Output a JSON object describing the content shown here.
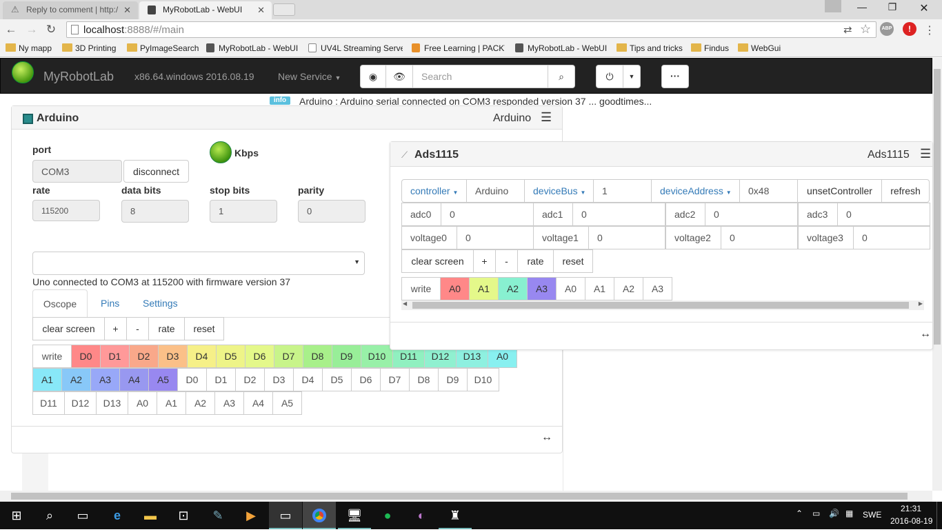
{
  "browser": {
    "tabs": [
      {
        "title": "Reply to comment | http:/"
      },
      {
        "title": "MyRobotLab - WebUI"
      }
    ],
    "url_host": "localhost",
    "url_rest": ":8888/#/main",
    "bookmarks": [
      "Ny mapp",
      "3D Printing",
      "PyImageSearch",
      "MyRobotLab - WebUI",
      "UV4L Streaming Serve",
      "Free Learning | PACKT",
      "MyRobotLab - WebUI",
      "Tips and tricks",
      "Findus",
      "WebGui"
    ],
    "ext_abp": "ABP"
  },
  "navbar": {
    "brand": "MyRobotLab",
    "platform": "x86.64.windows 2016.08.19",
    "new_service": "New Service",
    "search_placeholder": "Search",
    "more": "···"
  },
  "notice": {
    "badge": "info",
    "text": "Arduino : Arduino serial connected on COM3 responded version 37 ... goodtimes..."
  },
  "arduino": {
    "title": "Arduino",
    "header_right": "Arduino",
    "port_label": "port",
    "port_value": "COM3",
    "disconnect": "disconnect",
    "kbps": "Kbps",
    "rate_label": "rate",
    "rate_value": "115200",
    "databits_label": "data bits",
    "databits_value": "8",
    "stopbits_label": "stop bits",
    "stopbits_value": "1",
    "parity_label": "parity",
    "parity_value": "0",
    "status": "Uno connected to COM3 at 115200 with firmware version 37",
    "tabs": [
      "Oscope",
      "Pins",
      "Settings"
    ],
    "controls": [
      "clear screen",
      "+",
      "-",
      "rate",
      "reset"
    ],
    "pins_row1": [
      "write",
      "D0",
      "D1",
      "D2",
      "D3",
      "D4",
      "D5",
      "D6",
      "D7",
      "D8",
      "D9",
      "D10",
      "D11",
      "D12",
      "D13",
      "A0"
    ],
    "pins_row2": [
      "A1",
      "A2",
      "A3",
      "A4",
      "A5",
      "D0",
      "D1",
      "D2",
      "D3",
      "D4",
      "D5",
      "D6",
      "D7",
      "D8",
      "D9",
      "D10"
    ],
    "pins_row3": [
      "D11",
      "D12",
      "D13",
      "A0",
      "A1",
      "A2",
      "A3",
      "A4",
      "A5"
    ],
    "resize": "↔"
  },
  "ads": {
    "title": "Ads1115",
    "header_right": "Ads1115",
    "controller": "controller",
    "controller_value": "Arduino",
    "devicebus": "deviceBus",
    "devicebus_value": "1",
    "deviceaddress": "deviceAddress",
    "deviceaddress_value": "0x48",
    "unset": "unsetController",
    "refresh": "refresh",
    "adc": [
      {
        "label": "adc0",
        "value": "0"
      },
      {
        "label": "adc1",
        "value": "0"
      },
      {
        "label": "adc2",
        "value": "0"
      },
      {
        "label": "adc3",
        "value": "0"
      }
    ],
    "voltage": [
      {
        "label": "voltage0",
        "value": "0"
      },
      {
        "label": "voltage1",
        "value": "0"
      },
      {
        "label": "voltage2",
        "value": "0"
      },
      {
        "label": "voltage3",
        "value": "0"
      }
    ],
    "controls": [
      "clear screen",
      "+",
      "-",
      "rate",
      "reset"
    ],
    "pins": [
      "write",
      "A0",
      "A1",
      "A2",
      "A3",
      "A0",
      "A1",
      "A2",
      "A3"
    ],
    "resize": "↔"
  },
  "taskbar": {
    "language": "SWE",
    "time": "21:31",
    "date": "2016-08-19"
  },
  "colors": {
    "navbar": "#222222",
    "link": "#337ab7",
    "info_badge": "#5bc0de",
    "taskbar": "#101010"
  }
}
